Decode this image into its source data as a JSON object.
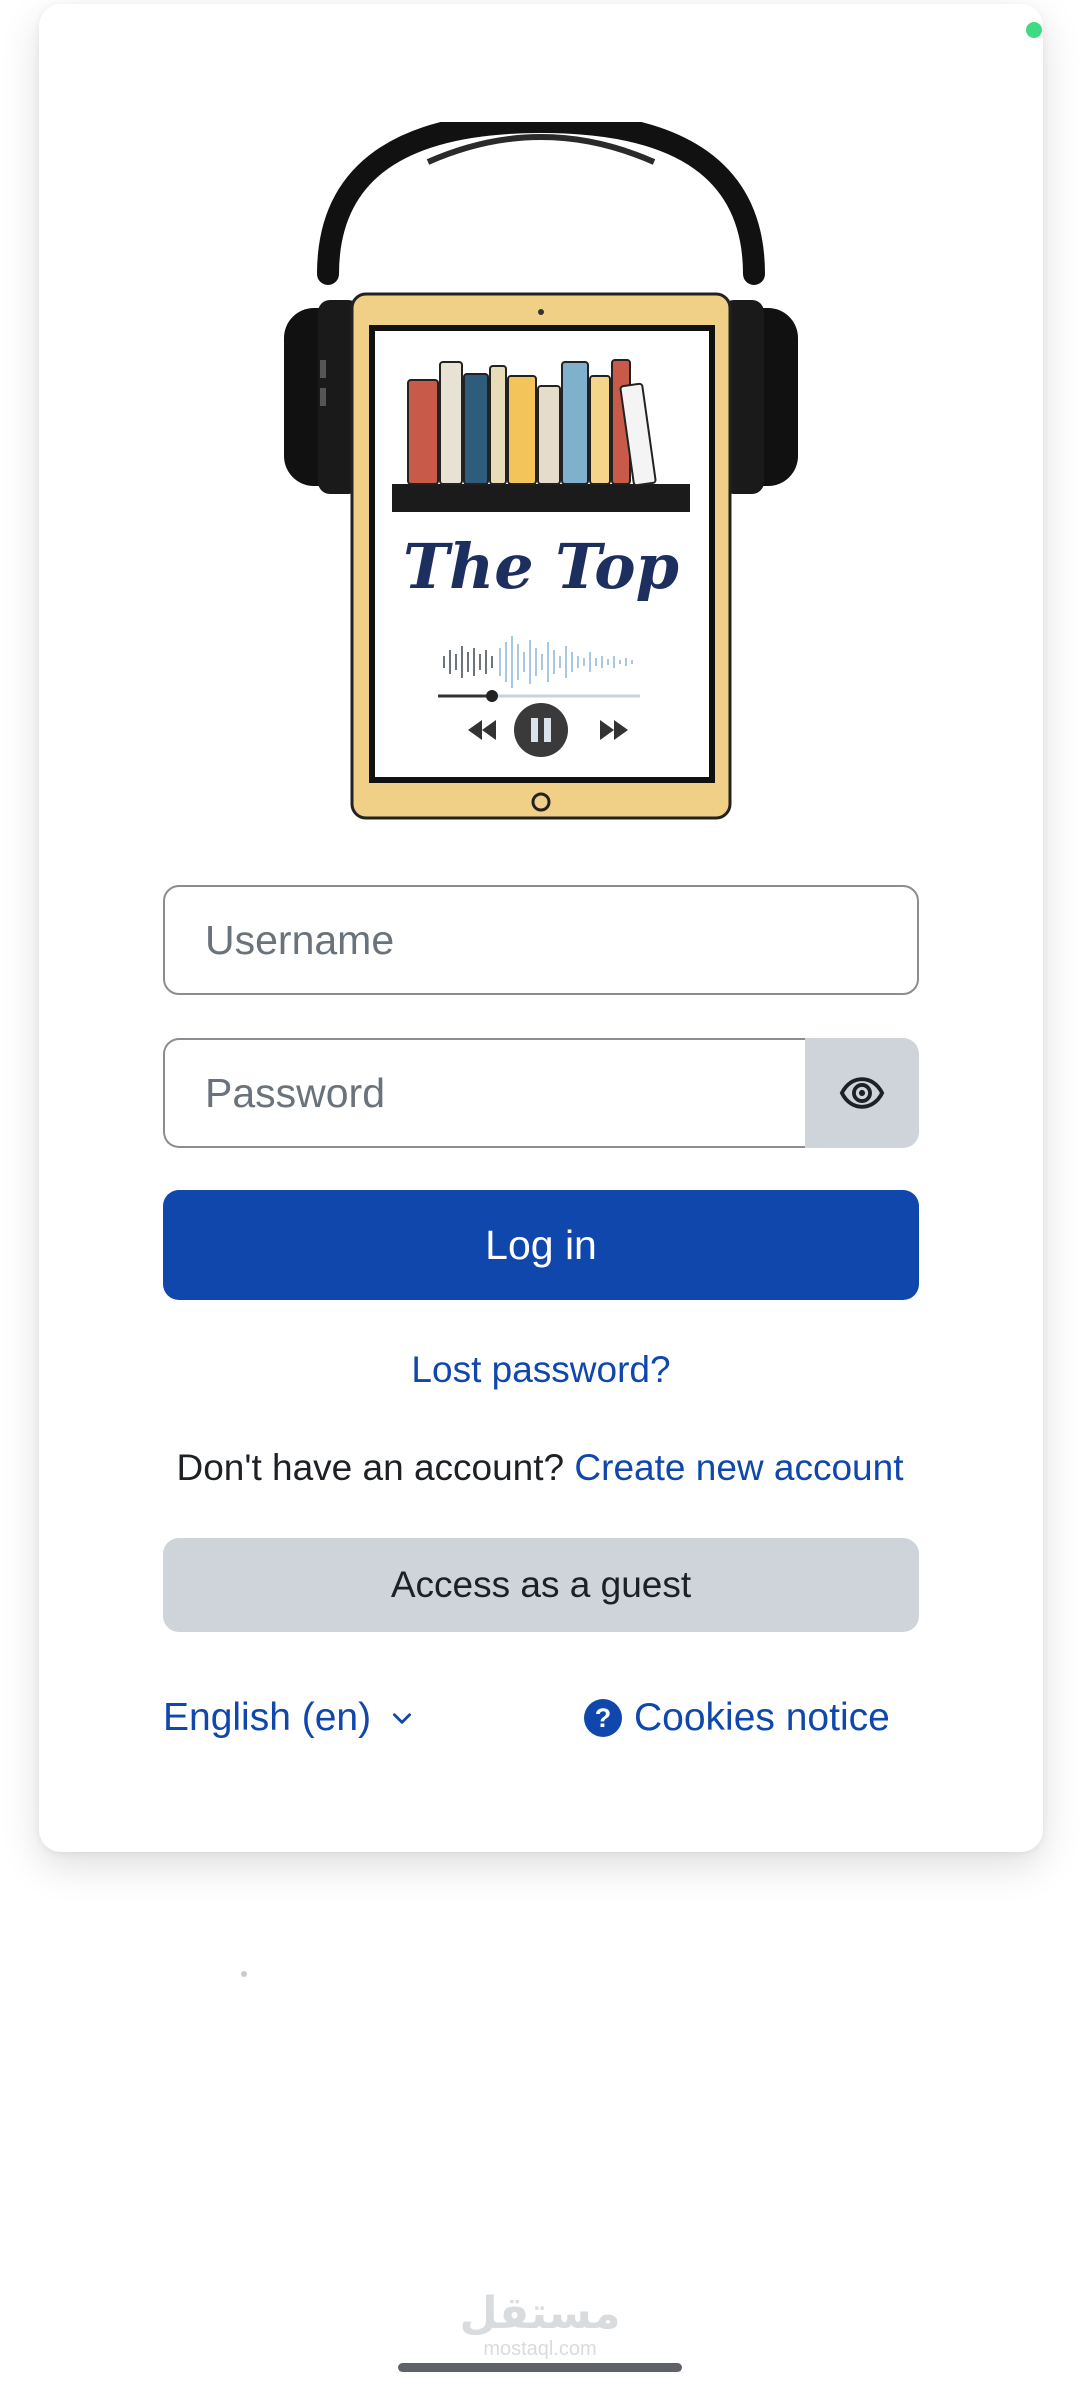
{
  "logo": {
    "brand_text": "The Top",
    "colors": {
      "navy": "#1c2f5e",
      "tablet_frame": "#f0cf86",
      "headphones": "#111111"
    }
  },
  "form": {
    "username_placeholder": "Username",
    "username_value": "",
    "password_placeholder": "Password",
    "password_value": "",
    "reveal_icon": "eye-icon",
    "login_label": "Log in",
    "lost_password_label": "Lost password?"
  },
  "signup": {
    "prompt": "Don't have an account?",
    "link_label": "Create new account"
  },
  "guest": {
    "label": "Access as a guest"
  },
  "footer": {
    "language_label": "English (en)",
    "language_icon": "chevron-down-icon",
    "cookies_label": "Cookies notice",
    "cookies_icon": "help-circle-icon"
  },
  "watermark": {
    "arabic": "مستقل",
    "latin": "mostaql.com"
  },
  "colors": {
    "primary": "#0f47ad",
    "secondary_button": "#ced4da",
    "border": "#8a8d91",
    "text": "#1d2125",
    "status_dot": "#3ddc84"
  }
}
